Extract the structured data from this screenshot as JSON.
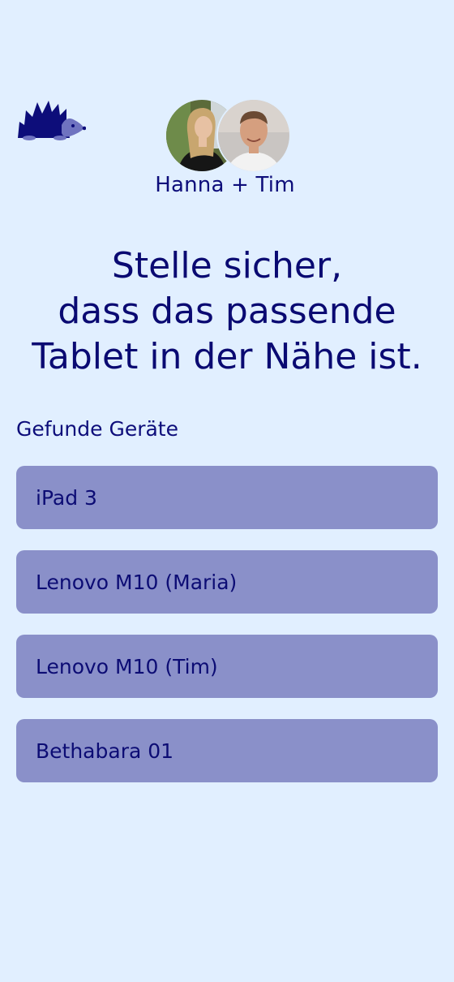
{
  "app": {
    "logo_icon": "hedgehog-icon",
    "colors": {
      "background": "#e1efff",
      "text": "#0d0d7a",
      "button": "#8a90c9"
    }
  },
  "users": {
    "label": "Hanna + Tim",
    "avatars": [
      {
        "name": "Hanna",
        "icon": "avatar-hanna"
      },
      {
        "name": "Tim",
        "icon": "avatar-tim"
      }
    ]
  },
  "headline": {
    "line1": "Stelle sicher,",
    "line2": "dass das passende",
    "line3": "Tablet in der Nähe ist."
  },
  "devices": {
    "section_label": "Gefunde Geräte",
    "items": [
      {
        "label": "iPad 3"
      },
      {
        "label": "Lenovo M10 (Maria)"
      },
      {
        "label": "Lenovo M10 (Tim)"
      },
      {
        "label": "Bethabara 01"
      }
    ]
  }
}
